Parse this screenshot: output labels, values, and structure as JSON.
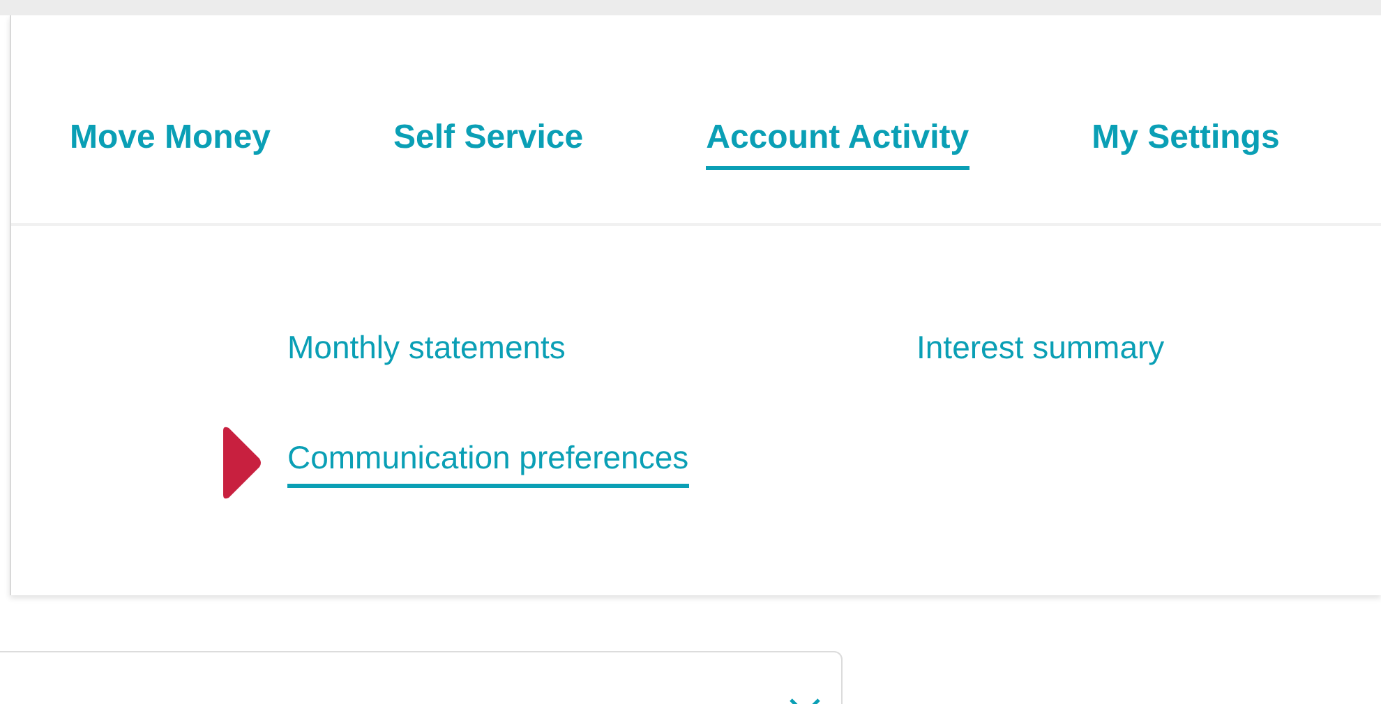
{
  "nav": {
    "tabs": [
      {
        "label": "Move Money",
        "selected": false
      },
      {
        "label": "Self Service",
        "selected": false
      },
      {
        "label": "Account Activity",
        "selected": true
      },
      {
        "label": "My Settings",
        "selected": false
      }
    ]
  },
  "submenu": {
    "links": [
      {
        "label": "Monthly statements",
        "selected": false
      },
      {
        "label": "Interest summary",
        "selected": false
      },
      {
        "label": "Communication preferences",
        "selected": true
      }
    ]
  },
  "dropdown": {
    "expanded": false
  }
}
